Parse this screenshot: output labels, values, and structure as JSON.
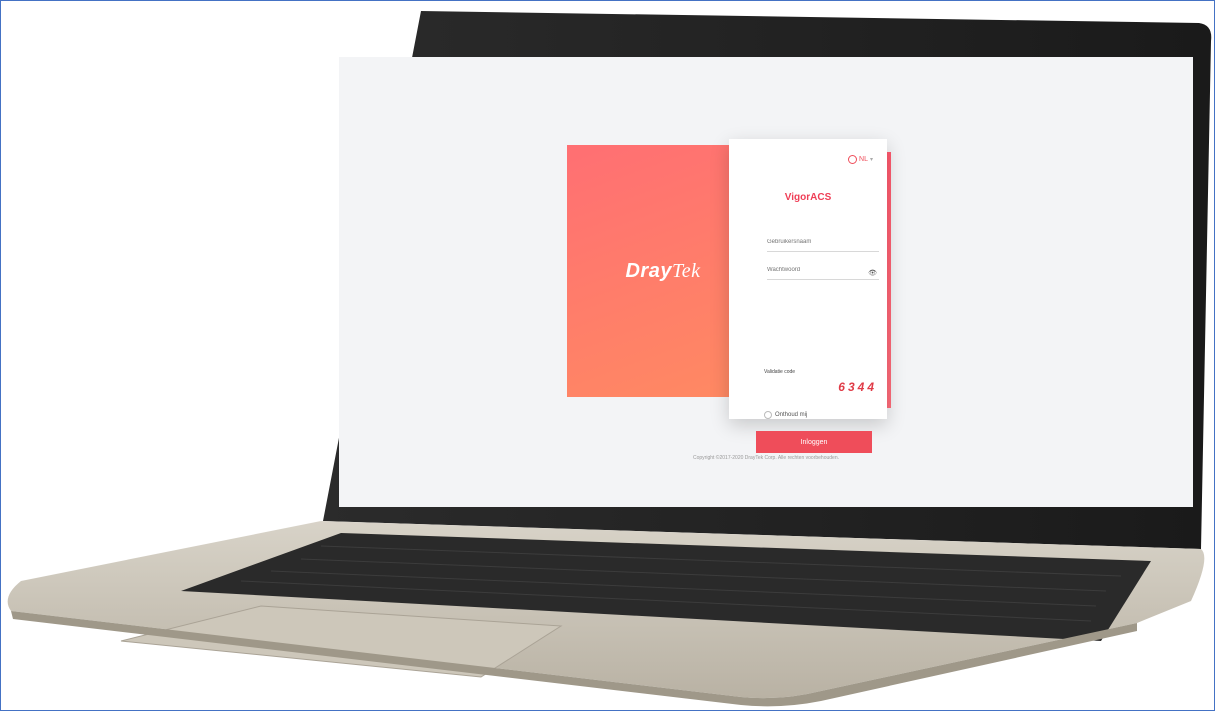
{
  "screen": {
    "brand_logo_a": "Dray",
    "brand_logo_b": "Tek",
    "language": "NL",
    "app_title": "VigorACS",
    "username_placeholder": "Gebruikersnaam",
    "password_placeholder": "Wachtwoord",
    "validation_label": "Validatie code",
    "captcha_value": "6344",
    "remember_label": "Onthoud mij",
    "login_button": "Inloggen",
    "copyright": "Copyright ©2017-2020 DrayTek Corp. Alle rechten voorbehouden."
  },
  "colors": {
    "accent": "#ef4d5a",
    "brand_gradient_start": "#ff6f73",
    "brand_gradient_end": "#ff8a62",
    "screen_bg": "#f3f4f6"
  },
  "icons": [
    "globe-icon",
    "chevron-down-icon",
    "eye-icon",
    "radio-icon"
  ]
}
